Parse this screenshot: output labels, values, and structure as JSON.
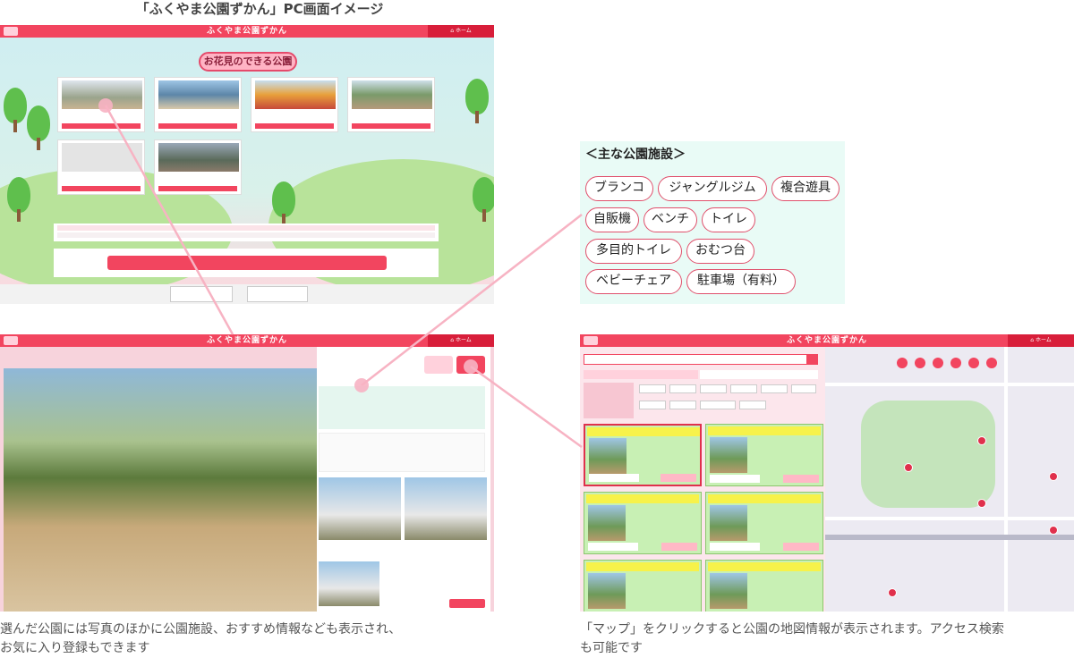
{
  "caption_top": "「ふくやま公園ずかん」PC画面イメージ",
  "app": {
    "title": "ふくやま公園ずかん",
    "home_label": "ホーム"
  },
  "top_page": {
    "hanami_title": "お花見のできる公園"
  },
  "facilities": {
    "title": "＜主な公園施設＞",
    "tags": [
      "ブランコ",
      "ジャングルジム",
      "複合遊具",
      "自販機",
      "ベンチ",
      "トイレ",
      "多目的トイレ",
      "おむつ台",
      "ベビーチェア",
      "駐車場（有料）"
    ]
  },
  "captions": {
    "detail": [
      "選んだ公園には写真のほかに公園施設、おすすめ情報なども表示され、",
      "お気に入り登録もできます"
    ],
    "map": [
      "「マップ」をクリックすると公園の地図情報が表示されます。アクセス検索",
      "も可能です"
    ]
  },
  "colors": {
    "accent": "#f2455f",
    "accent_dark": "#d81e3a",
    "facility_bg": "#e9fbf6",
    "tag_border": "#e0506c"
  }
}
